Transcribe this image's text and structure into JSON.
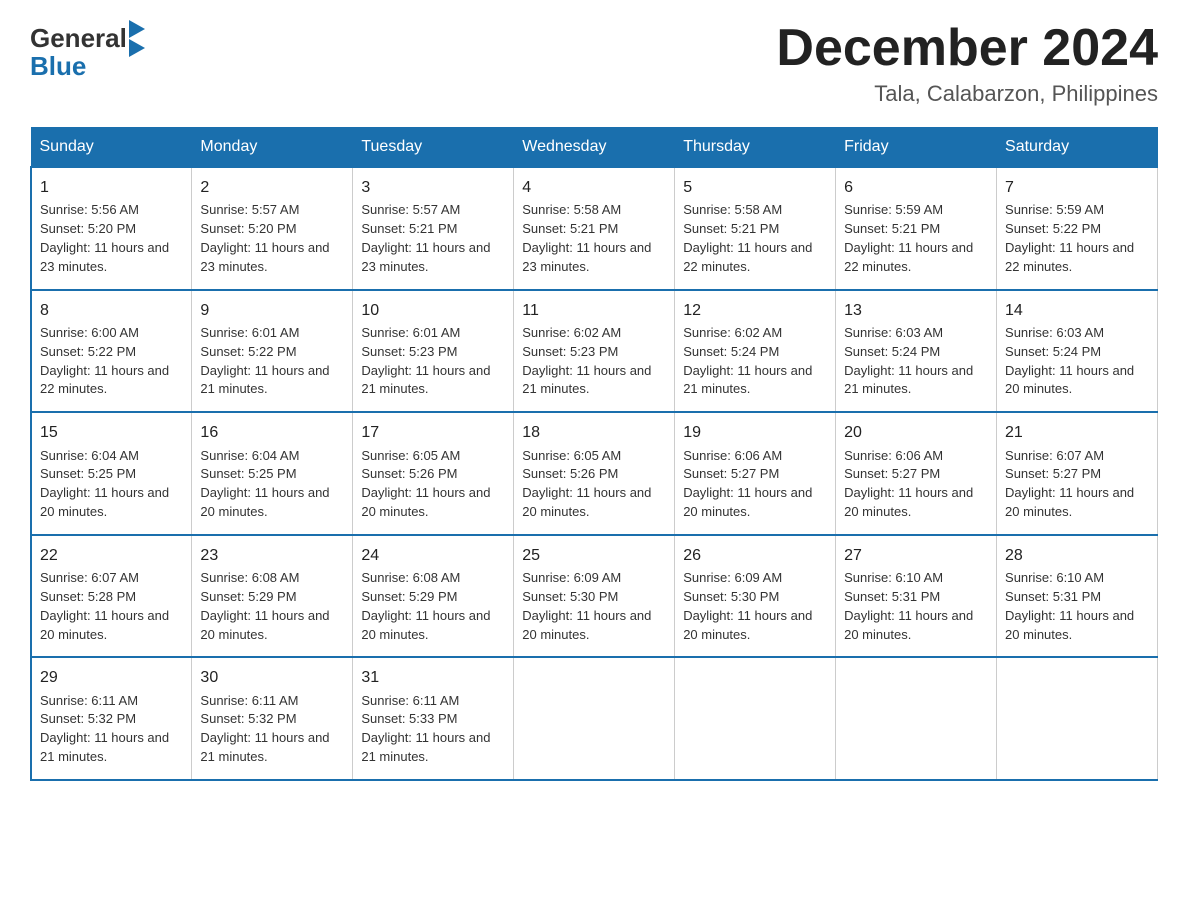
{
  "logo": {
    "general": "General",
    "blue": "Blue"
  },
  "title": "December 2024",
  "location": "Tala, Calabarzon, Philippines",
  "days_of_week": [
    "Sunday",
    "Monday",
    "Tuesday",
    "Wednesday",
    "Thursday",
    "Friday",
    "Saturday"
  ],
  "weeks": [
    [
      {
        "day": "1",
        "sunrise": "5:56 AM",
        "sunset": "5:20 PM",
        "daylight": "11 hours and 23 minutes."
      },
      {
        "day": "2",
        "sunrise": "5:57 AM",
        "sunset": "5:20 PM",
        "daylight": "11 hours and 23 minutes."
      },
      {
        "day": "3",
        "sunrise": "5:57 AM",
        "sunset": "5:21 PM",
        "daylight": "11 hours and 23 minutes."
      },
      {
        "day": "4",
        "sunrise": "5:58 AM",
        "sunset": "5:21 PM",
        "daylight": "11 hours and 23 minutes."
      },
      {
        "day": "5",
        "sunrise": "5:58 AM",
        "sunset": "5:21 PM",
        "daylight": "11 hours and 22 minutes."
      },
      {
        "day": "6",
        "sunrise": "5:59 AM",
        "sunset": "5:21 PM",
        "daylight": "11 hours and 22 minutes."
      },
      {
        "day": "7",
        "sunrise": "5:59 AM",
        "sunset": "5:22 PM",
        "daylight": "11 hours and 22 minutes."
      }
    ],
    [
      {
        "day": "8",
        "sunrise": "6:00 AM",
        "sunset": "5:22 PM",
        "daylight": "11 hours and 22 minutes."
      },
      {
        "day": "9",
        "sunrise": "6:01 AM",
        "sunset": "5:22 PM",
        "daylight": "11 hours and 21 minutes."
      },
      {
        "day": "10",
        "sunrise": "6:01 AM",
        "sunset": "5:23 PM",
        "daylight": "11 hours and 21 minutes."
      },
      {
        "day": "11",
        "sunrise": "6:02 AM",
        "sunset": "5:23 PM",
        "daylight": "11 hours and 21 minutes."
      },
      {
        "day": "12",
        "sunrise": "6:02 AM",
        "sunset": "5:24 PM",
        "daylight": "11 hours and 21 minutes."
      },
      {
        "day": "13",
        "sunrise": "6:03 AM",
        "sunset": "5:24 PM",
        "daylight": "11 hours and 21 minutes."
      },
      {
        "day": "14",
        "sunrise": "6:03 AM",
        "sunset": "5:24 PM",
        "daylight": "11 hours and 20 minutes."
      }
    ],
    [
      {
        "day": "15",
        "sunrise": "6:04 AM",
        "sunset": "5:25 PM",
        "daylight": "11 hours and 20 minutes."
      },
      {
        "day": "16",
        "sunrise": "6:04 AM",
        "sunset": "5:25 PM",
        "daylight": "11 hours and 20 minutes."
      },
      {
        "day": "17",
        "sunrise": "6:05 AM",
        "sunset": "5:26 PM",
        "daylight": "11 hours and 20 minutes."
      },
      {
        "day": "18",
        "sunrise": "6:05 AM",
        "sunset": "5:26 PM",
        "daylight": "11 hours and 20 minutes."
      },
      {
        "day": "19",
        "sunrise": "6:06 AM",
        "sunset": "5:27 PM",
        "daylight": "11 hours and 20 minutes."
      },
      {
        "day": "20",
        "sunrise": "6:06 AM",
        "sunset": "5:27 PM",
        "daylight": "11 hours and 20 minutes."
      },
      {
        "day": "21",
        "sunrise": "6:07 AM",
        "sunset": "5:27 PM",
        "daylight": "11 hours and 20 minutes."
      }
    ],
    [
      {
        "day": "22",
        "sunrise": "6:07 AM",
        "sunset": "5:28 PM",
        "daylight": "11 hours and 20 minutes."
      },
      {
        "day": "23",
        "sunrise": "6:08 AM",
        "sunset": "5:29 PM",
        "daylight": "11 hours and 20 minutes."
      },
      {
        "day": "24",
        "sunrise": "6:08 AM",
        "sunset": "5:29 PM",
        "daylight": "11 hours and 20 minutes."
      },
      {
        "day": "25",
        "sunrise": "6:09 AM",
        "sunset": "5:30 PM",
        "daylight": "11 hours and 20 minutes."
      },
      {
        "day": "26",
        "sunrise": "6:09 AM",
        "sunset": "5:30 PM",
        "daylight": "11 hours and 20 minutes."
      },
      {
        "day": "27",
        "sunrise": "6:10 AM",
        "sunset": "5:31 PM",
        "daylight": "11 hours and 20 minutes."
      },
      {
        "day": "28",
        "sunrise": "6:10 AM",
        "sunset": "5:31 PM",
        "daylight": "11 hours and 20 minutes."
      }
    ],
    [
      {
        "day": "29",
        "sunrise": "6:11 AM",
        "sunset": "5:32 PM",
        "daylight": "11 hours and 21 minutes."
      },
      {
        "day": "30",
        "sunrise": "6:11 AM",
        "sunset": "5:32 PM",
        "daylight": "11 hours and 21 minutes."
      },
      {
        "day": "31",
        "sunrise": "6:11 AM",
        "sunset": "5:33 PM",
        "daylight": "11 hours and 21 minutes."
      },
      null,
      null,
      null,
      null
    ]
  ]
}
